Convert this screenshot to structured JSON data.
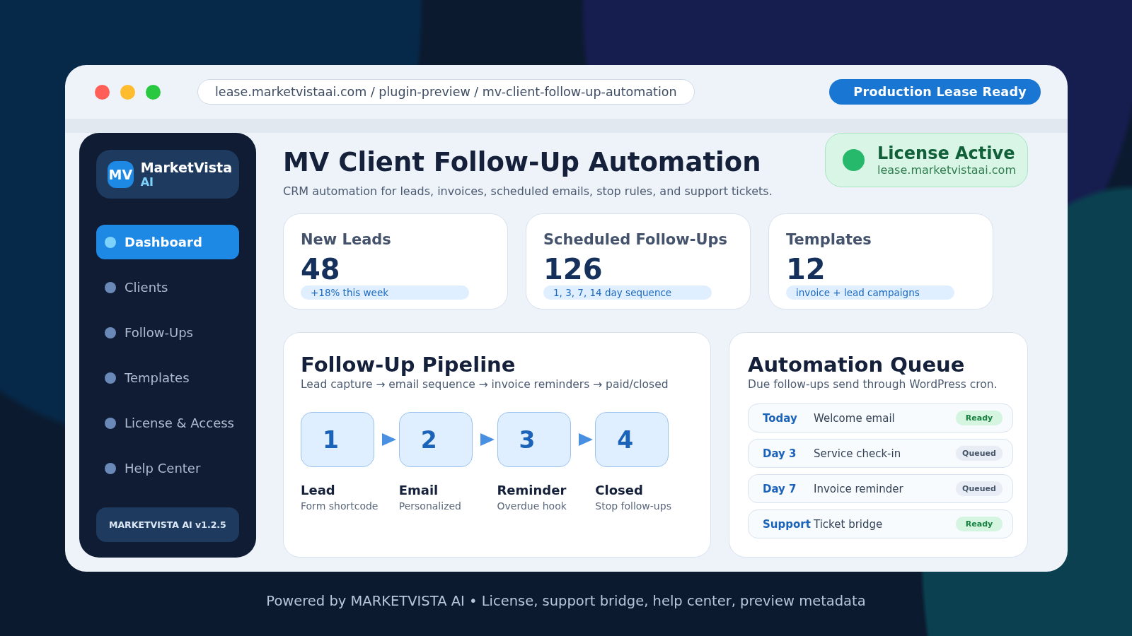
{
  "browser": {
    "address": "lease.marketvistaai.com / plugin-preview / mv-client-follow-up-automation",
    "status_button": "Production Lease Ready"
  },
  "sidebar": {
    "logo": "MV",
    "brand": "MarketVista",
    "brand_sub": "AI",
    "items": [
      {
        "label": "Dashboard",
        "selected": true
      },
      {
        "label": "Clients",
        "selected": false
      },
      {
        "label": "Follow-Ups",
        "selected": false
      },
      {
        "label": "Templates",
        "selected": false
      },
      {
        "label": "License & Access",
        "selected": false
      },
      {
        "label": "Help Center",
        "selected": false
      }
    ],
    "version": "MARKETVISTA AI v1.2.5"
  },
  "header": {
    "title": "MV Client Follow-Up Automation",
    "subtitle": "CRM automation for leads, invoices, scheduled emails, stop rules, and support tickets."
  },
  "license": {
    "title": "License Active",
    "domain": "lease.marketvistaai.com"
  },
  "stats": [
    {
      "title": "New Leads",
      "value": "48",
      "note": "+18% this week"
    },
    {
      "title": "Scheduled Follow-Ups",
      "value": "126",
      "note": "1, 3, 7, 14 day sequence"
    },
    {
      "title": "Templates",
      "value": "12",
      "note": "invoice + lead campaigns"
    }
  ],
  "pipeline": {
    "title": "Follow-Up Pipeline",
    "subtitle": "Lead capture → email sequence → invoice reminders → paid/closed",
    "steps": [
      {
        "number": "1",
        "label": "Lead",
        "detail": "Form shortcode"
      },
      {
        "number": "2",
        "label": "Email",
        "detail": "Personalized"
      },
      {
        "number": "3",
        "label": "Reminder",
        "detail": "Overdue hook"
      },
      {
        "number": "4",
        "label": "Closed",
        "detail": "Stop follow-ups"
      }
    ]
  },
  "queue": {
    "title": "Automation Queue",
    "subtitle": "Due follow-ups send through WordPress cron.",
    "rows": [
      {
        "when": "Today",
        "task": "Welcome email",
        "status": "Ready",
        "kind": "ready"
      },
      {
        "when": "Day 3",
        "task": "Service check-in",
        "status": "Queued",
        "kind": "queued"
      },
      {
        "when": "Day 7",
        "task": "Invoice reminder",
        "status": "Queued",
        "kind": "queued"
      },
      {
        "when": "Support",
        "task": "Ticket bridge",
        "status": "Ready",
        "kind": "ready"
      }
    ]
  },
  "footer": "Powered by MARKETVISTA AI • License, support bridge, help center, preview metadata"
}
